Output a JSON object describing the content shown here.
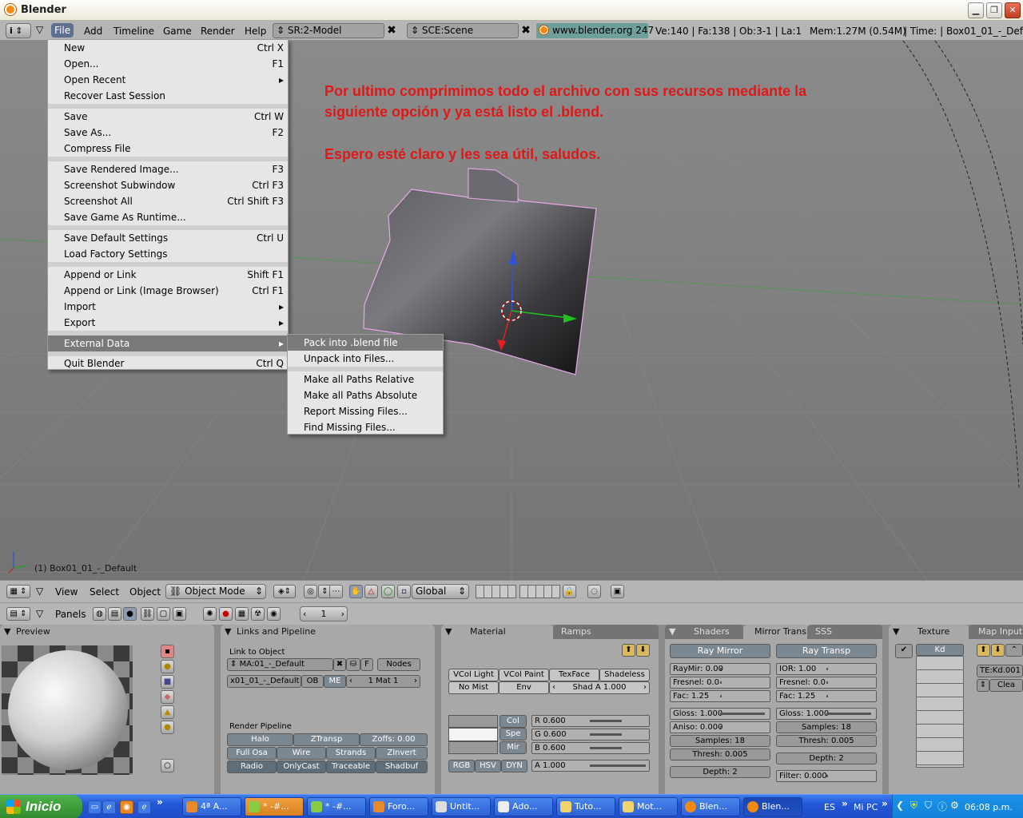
{
  "window": {
    "title": "Blender"
  },
  "header": {
    "menus": [
      "File",
      "Add",
      "Timeline",
      "Game",
      "Render",
      "Help"
    ],
    "screen": "SR:2-Model",
    "scene": "SCE:Scene",
    "website": "www.blender.org 247",
    "stats": "Ve:140 | Fa:138 | Ob:3-1 | La:1",
    "memory": "Mem:1.27M (0.54M)",
    "time": "| Time: | Box01_01_-_Def"
  },
  "viewport": {
    "annotation_line1": "Por ultimo comprimimos todo el archivo con sus recursos mediante la",
    "annotation_line2": "siguiente opción y ya está listo el .blend.",
    "annotation_line3": "Espero esté claro y les sea útil, saludos.",
    "object_label": "(1) Box01_01_-_Default"
  },
  "file_menu": {
    "items": [
      {
        "label": "New",
        "shortcut": "Ctrl X"
      },
      {
        "label": "Open...",
        "shortcut": "F1"
      },
      {
        "label": "Open Recent",
        "shortcut": "▸"
      },
      {
        "label": "Recover Last Session",
        "shortcut": ""
      },
      {
        "label": "Save",
        "shortcut": "Ctrl W"
      },
      {
        "label": "Save As...",
        "shortcut": "F2"
      },
      {
        "label": "Compress File",
        "shortcut": ""
      },
      {
        "label": "Save Rendered Image...",
        "shortcut": "F3"
      },
      {
        "label": "Screenshot Subwindow",
        "shortcut": "Ctrl F3"
      },
      {
        "label": "Screenshot All",
        "shortcut": "Ctrl Shift F3"
      },
      {
        "label": "Save Game As Runtime...",
        "shortcut": ""
      },
      {
        "label": "Save Default Settings",
        "shortcut": "Ctrl U"
      },
      {
        "label": "Load Factory Settings",
        "shortcut": ""
      },
      {
        "label": "Append or Link",
        "shortcut": "Shift F1"
      },
      {
        "label": "Append or Link (Image Browser)",
        "shortcut": "Ctrl F1"
      },
      {
        "label": "Import",
        "shortcut": "▸"
      },
      {
        "label": "Export",
        "shortcut": "▸"
      },
      {
        "label": "External Data",
        "shortcut": "▸"
      },
      {
        "label": "Quit Blender",
        "shortcut": "Ctrl Q"
      }
    ]
  },
  "external_data_menu": {
    "items": [
      "Pack into .blend file",
      "Unpack into Files...",
      "Make all Paths Relative",
      "Make all Paths Absolute",
      "Report Missing Files...",
      "Find Missing Files..."
    ]
  },
  "view3d_header": {
    "view": "View",
    "select": "Select",
    "object": "Object",
    "mode": "Object Mode",
    "orientation": "Global"
  },
  "buttons_header": {
    "panels": "Panels",
    "frame": "1"
  },
  "preview": {
    "tab": "Preview"
  },
  "links": {
    "tab": "Links and Pipeline",
    "link_to_object": "Link to Object",
    "material_name": "MA:01_-_Default",
    "f_label": "F",
    "nodes": "Nodes",
    "object_name": "x01_01_-_Default",
    "ob": "OB",
    "me": "ME",
    "mat_count": "1 Mat 1",
    "render_pipeline": "Render Pipeline",
    "halo": "Halo",
    "ztransp": "ZTransp",
    "zoffs": "Zoffs: 0.00",
    "full_osa": "Full Osa",
    "wire": "Wire",
    "strands": "Strands",
    "zinvert": "ZInvert",
    "radio": "Radio",
    "onlycast": "OnlyCast",
    "traceable": "Traceable",
    "shadbuf": "Shadbuf"
  },
  "material": {
    "tab": "Material",
    "tab2": "Ramps",
    "vcol_light": "VCol Light",
    "vcol_paint": "VCol Paint",
    "texface": "TexFace",
    "shadeless": "Shadeless",
    "no_mist": "No Mist",
    "env": "Env",
    "shad_a": "Shad A 1.000",
    "col": "Col",
    "spe": "Spe",
    "mir": "Mir",
    "r": "R 0.600",
    "g": "G 0.600",
    "b": "B 0.600",
    "a": "A 1.000",
    "rgb": "RGB",
    "hsv": "HSV",
    "dyn": "DYN"
  },
  "shaders": {
    "tab": "Shaders",
    "tab2": "Mirror Transp",
    "tab3": "SSS",
    "ray_mirror": "Ray Mirror",
    "ray_transp": "Ray Transp",
    "raymir": "RayMir: 0.00",
    "ior": "IOR: 1.00",
    "fresnel1": "Fresnel: 0.0",
    "fresnel2": "Fresnel: 0.0",
    "fac1": "Fac: 1.25",
    "fac2": "Fac: 1.25",
    "gloss1": "Gloss: 1.000",
    "gloss2": "Gloss: 1.000",
    "aniso": "Aniso: 0.000",
    "samples2": "Samples: 18",
    "samples1": "Samples: 18",
    "thresh2": "Thresh: 0.005",
    "thresh1": "Thresh: 0.005",
    "depth2": "Depth: 2",
    "depth1": "Depth: 2",
    "filter": "Filter: 0.000"
  },
  "texture": {
    "tab": "Texture",
    "tab2": "Map Input",
    "kd": "Kd",
    "te": "TE:Kd.001",
    "clear": "Clea"
  },
  "taskbar": {
    "start": "Inicio",
    "tasks": [
      "4ª A...",
      "* -#...",
      "* -#...",
      "Foro...",
      "Untit...",
      "Ado...",
      "Tuto...",
      "Mot...",
      "Blen...",
      "Blen..."
    ],
    "lang": "ES",
    "mypc": "Mi PC",
    "clock": "06:08 p.m."
  },
  "colors": {
    "accent": "#f08a10",
    "annotation": "#e01818",
    "menu_bg": "#e6e6e6",
    "menu_highlight": "#7a7a7a"
  }
}
